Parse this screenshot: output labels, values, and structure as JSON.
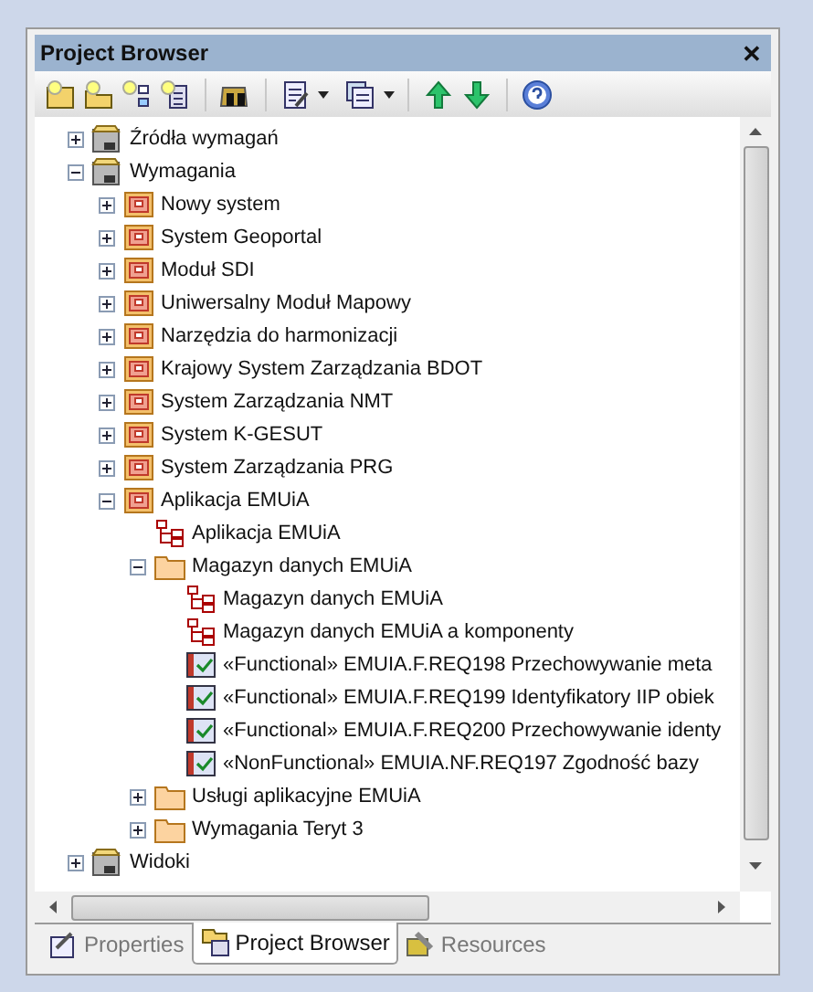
{
  "window": {
    "title": "Project Browser",
    "close": "✕"
  },
  "tree": [
    {
      "kind": "model",
      "label": "Źródła wymagań",
      "expanded": false
    },
    {
      "kind": "model",
      "label": "Wymagania",
      "expanded": true,
      "children": [
        {
          "kind": "package",
          "label": "Nowy system",
          "expanded": false
        },
        {
          "kind": "package",
          "label": "System Geoportal",
          "expanded": false
        },
        {
          "kind": "package",
          "label": "Moduł SDI",
          "expanded": false
        },
        {
          "kind": "package",
          "label": "Uniwersalny Moduł Mapowy",
          "expanded": false
        },
        {
          "kind": "package",
          "label": "Narzędzia do harmonizacji",
          "expanded": false
        },
        {
          "kind": "package",
          "label": "Krajowy System Zarządzania BDOT",
          "expanded": false
        },
        {
          "kind": "package",
          "label": "System Zarządzania NMT",
          "expanded": false
        },
        {
          "kind": "package",
          "label": "System K-GESUT",
          "expanded": false
        },
        {
          "kind": "package",
          "label": "System Zarządzania PRG",
          "expanded": false
        },
        {
          "kind": "package",
          "label": "Aplikacja EMUiA",
          "expanded": true,
          "children": [
            {
              "kind": "diagram",
              "label": "Aplikacja EMUiA"
            },
            {
              "kind": "folder",
              "label": "Magazyn danych EMUiA",
              "expanded": true,
              "children": [
                {
                  "kind": "diagram",
                  "label": "Magazyn danych EMUiA"
                },
                {
                  "kind": "diagram",
                  "label": "Magazyn danych EMUiA a komponenty"
                },
                {
                  "kind": "requirement",
                  "label": "«Functional» EMUIA.F.REQ198 Przechowywanie meta"
                },
                {
                  "kind": "requirement",
                  "label": "«Functional» EMUIA.F.REQ199 Identyfikatory IIP obiek"
                },
                {
                  "kind": "requirement",
                  "label": "«Functional» EMUIA.F.REQ200 Przechowywanie identy"
                },
                {
                  "kind": "requirement",
                  "label": "«NonFunctional» EMUIA.NF.REQ197 Zgodność bazy"
                }
              ]
            },
            {
              "kind": "folder",
              "label": "Usługi aplikacyjne EMUiA",
              "expanded": false
            },
            {
              "kind": "folder",
              "label": "Wymagania Teryt 3",
              "expanded": false
            }
          ]
        }
      ]
    },
    {
      "kind": "model",
      "label": "Widoki",
      "expanded": false
    }
  ],
  "tabs": [
    {
      "label": "Properties",
      "selected": false
    },
    {
      "label": "Project Browser",
      "selected": true
    },
    {
      "label": "Resources",
      "selected": false
    }
  ]
}
